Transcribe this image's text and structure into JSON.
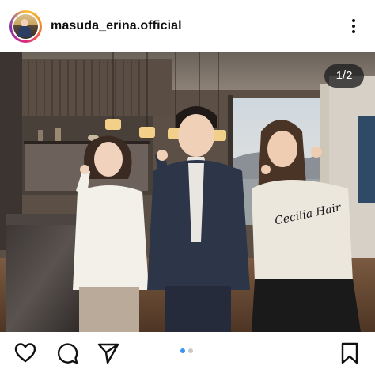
{
  "post": {
    "username": "masuda_erina.official",
    "image_counter": "1/2",
    "current_slide": 1,
    "total_slides": 2
  },
  "icons": {
    "more": "more-vertical-icon",
    "like": "heart-icon",
    "comment": "comment-bubble-icon",
    "share": "paper-plane-icon",
    "save": "bookmark-icon"
  },
  "colors": {
    "carousel_dot_active": "#3897f0",
    "carousel_dot_inactive": "#c7c7c7",
    "counter_badge": "#1e1e1e"
  },
  "photo": {
    "sweater_text": "Cecilia Hair"
  }
}
